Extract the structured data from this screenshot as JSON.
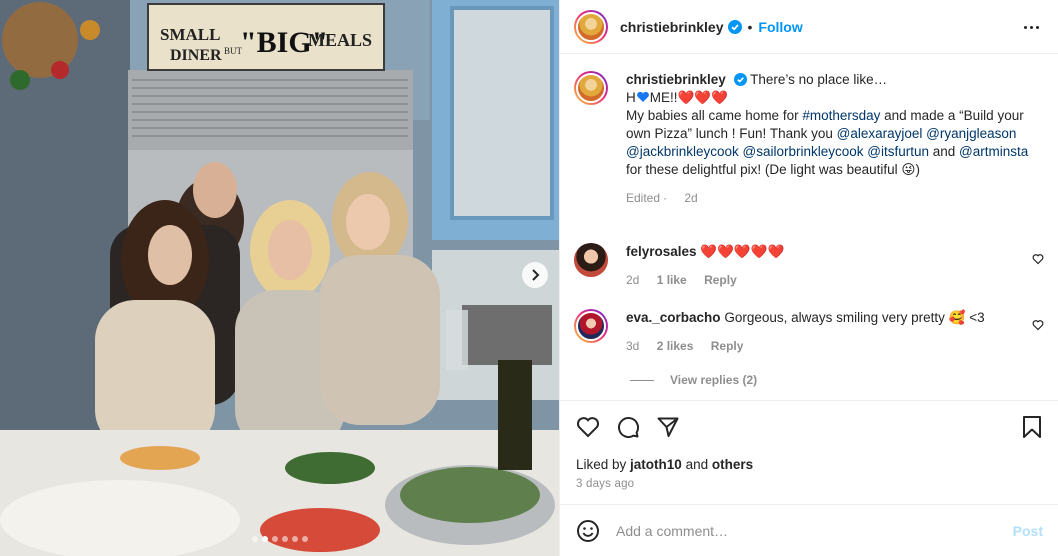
{
  "photo": {
    "sign_text": "SMALL DINER BUT BIG MEALS",
    "sign_parts": [
      "SMALL",
      "DINER",
      "BUT",
      "\"BIG\"",
      "MEALS"
    ],
    "carousel_dots": 6,
    "active_dot": 1
  },
  "header": {
    "username": "christiebrinkley",
    "bullet": "•",
    "follow": "Follow"
  },
  "caption": {
    "username": "christiebrinkley",
    "line1": "There’s no place like…",
    "line2_a": "H",
    "line2_b": "ME!!",
    "line2_hearts": "❤️❤️❤️",
    "text_1": "My babies all came home for ",
    "tag_mothersday": "#mothersday",
    "text_2": " and made a “Build your own Pizza” lunch ! Fun! Thank you ",
    "mention_1": "@alexarayjoel",
    "mention_2": "@ryanjgleason",
    "mention_3": "@jackbrinkleycook",
    "mention_4": "@sailorbrinkleycook",
    "mention_5": "@itsfurtun",
    "text_3": " and ",
    "mention_6": "@artminsta",
    "text_4": " for these delightful pix! (De light was beautiful ",
    "emoji_end": "😜)",
    "edited": "Edited",
    "time": "2d"
  },
  "comments": [
    {
      "username": "felyrosales",
      "text": "❤️❤️❤️❤️❤️",
      "time": "2d",
      "likes": "1 like",
      "reply": "Reply"
    },
    {
      "username": "eva._corbacho",
      "text": "Gorgeous, always smiling very pretty 🥰 <3",
      "time": "3d",
      "likes": "2 likes",
      "reply": "Reply"
    }
  ],
  "view_replies": "View replies (2)",
  "likes": {
    "prefix": "Liked by ",
    "user": "jatoth10",
    "middle": " and ",
    "others": "others"
  },
  "date": "3 days ago",
  "add_comment": {
    "placeholder": "Add a comment…",
    "post": "Post"
  },
  "colors": {
    "accent": "#0095f6",
    "link": "#00376b",
    "muted": "#8e8e8e",
    "heart": "#ed4956",
    "post_disabled": "#b2dffc"
  },
  "icons": [
    "verified-icon",
    "more-options-icon",
    "heart-icon",
    "comment-icon",
    "share-icon",
    "bookmark-icon",
    "emoji-icon",
    "chevron-right-icon"
  ]
}
